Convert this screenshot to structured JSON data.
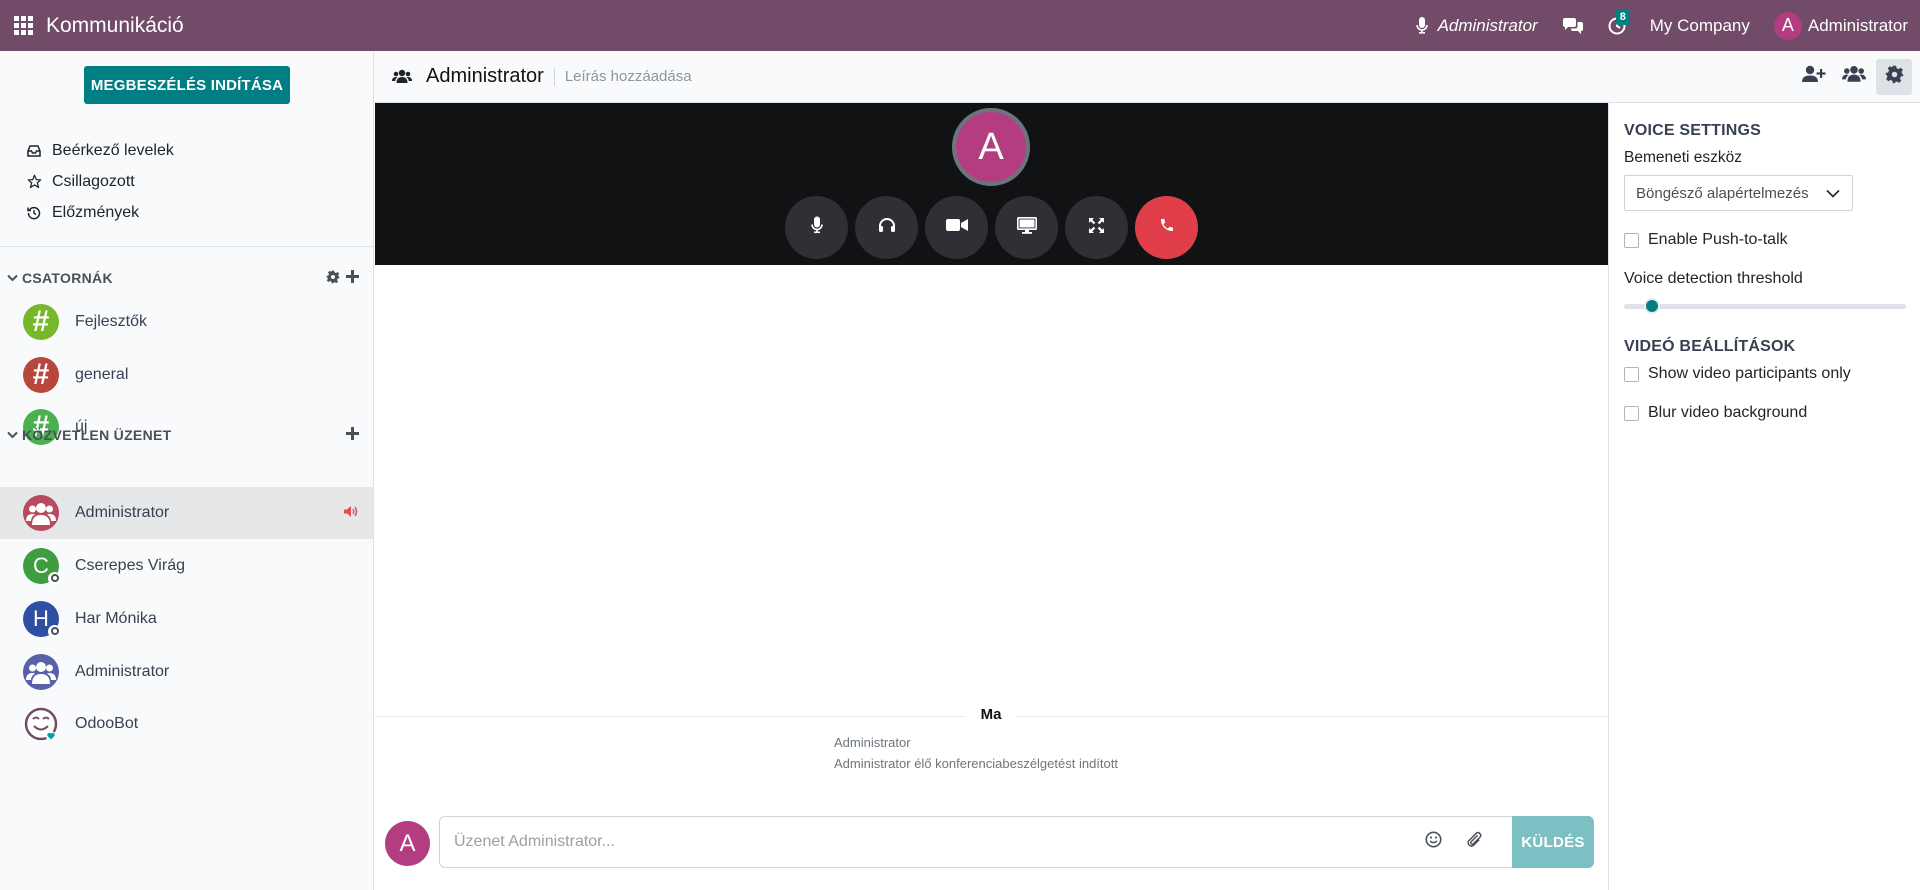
{
  "navbar": {
    "app_title": "Kommunikáció",
    "voice_user": "Administrator",
    "activity_count": "8",
    "company": "My Company",
    "user_initial": "A",
    "user_name": "Administrator",
    "color": "#714b67"
  },
  "sidebar": {
    "start_meeting": "MEGBESZÉLÉS INDÍTÁSA",
    "mailboxes": [
      {
        "label": "Beérkező levelek",
        "icon": "inbox-icon"
      },
      {
        "label": "Csillagozott",
        "icon": "star-icon"
      },
      {
        "label": "Előzmények",
        "icon": "history-icon"
      }
    ],
    "channels_header": "CSATORNÁK",
    "channels": [
      {
        "label": "Fejlesztők",
        "color": "#76b82a"
      },
      {
        "label": "general",
        "color": "#b7463c"
      },
      {
        "label": "új",
        "color": "#4caf50"
      }
    ],
    "dm_header": "KÖZVETLEN ÜZENET",
    "direct_messages": [
      {
        "label": "Administrator",
        "initial": "",
        "color": "#b74a5c",
        "active": true
      },
      {
        "label": "Cserepes Virág",
        "initial": "C",
        "color": "#3f9d3f"
      },
      {
        "label": "Har Mónika",
        "initial": "H",
        "color": "#2f4fa3"
      },
      {
        "label": "Administrator",
        "initial": "",
        "color": "#5860a8"
      },
      {
        "label": "OdooBot",
        "initial": "",
        "color": "#714b67"
      }
    ]
  },
  "thread": {
    "title": "Administrator",
    "description_placeholder": "Leírás hozzáadása"
  },
  "call": {
    "avatar_initial": "A",
    "avatar_color": "#b43d82",
    "hangup_color": "#e03f4a"
  },
  "messages": {
    "day": "Ma",
    "author": "Administrator",
    "body": "Administrator élő konferenciabeszélgetést indított"
  },
  "composer": {
    "avatar_initial": "A",
    "placeholder": "Üzenet Administrator...",
    "send_label": "KÜLDÉS"
  },
  "settings": {
    "voice_title": "VOICE SETTINGS",
    "input_device_label": "Bemeneti eszköz",
    "input_device_value": "Böngésző alapértelmezés",
    "push_to_talk": "Enable Push-to-talk",
    "threshold_label": "Voice detection threshold",
    "threshold_value": 0.07,
    "video_title": "VIDEÓ BEÁLLÍTÁSOK",
    "video_only": "Show video participants only",
    "blur_bg": "Blur video background",
    "accent": "#017e84"
  }
}
